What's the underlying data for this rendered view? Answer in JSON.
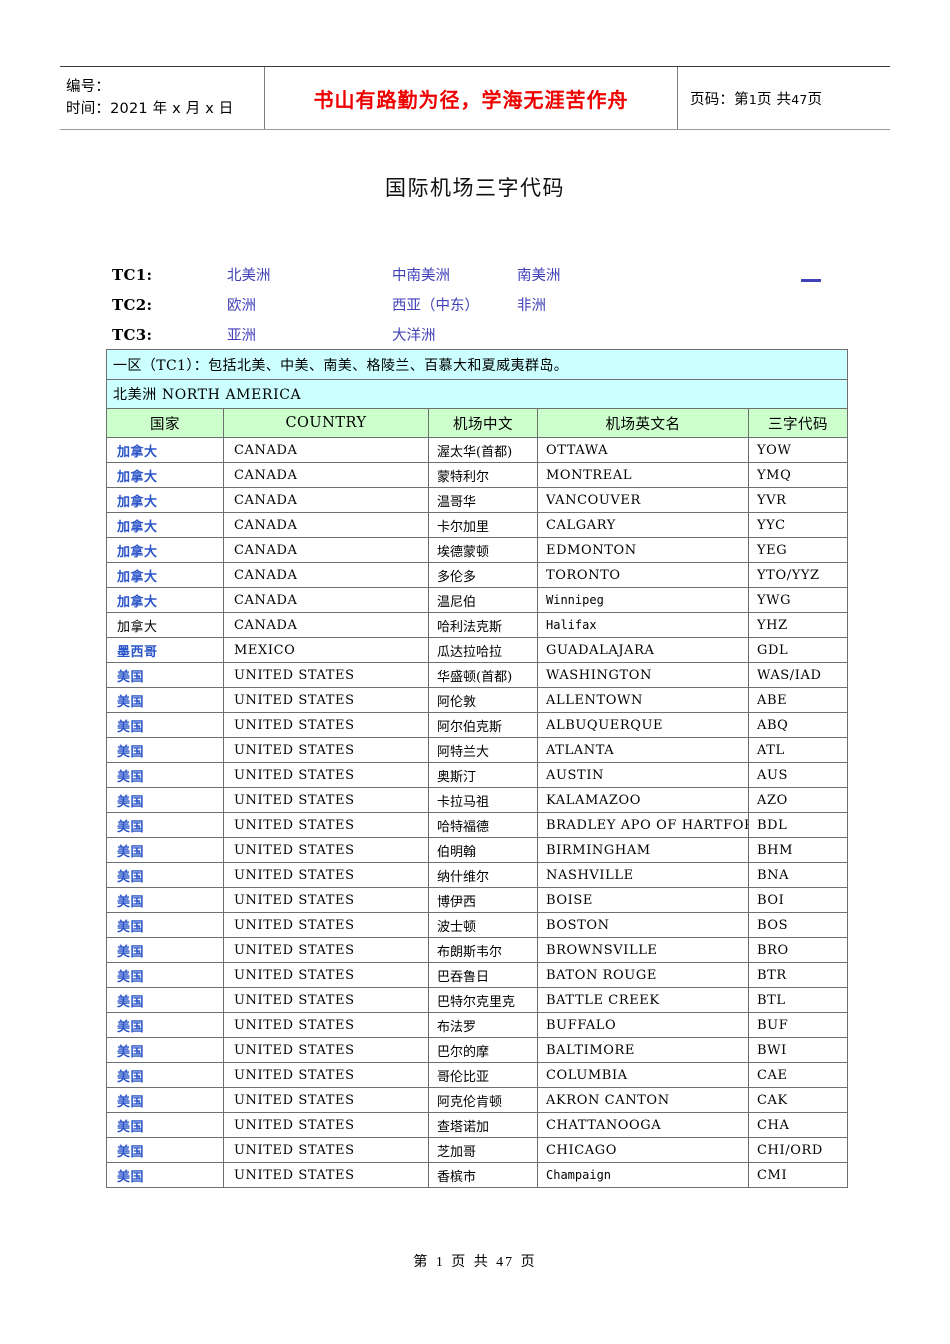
{
  "page_header": {
    "doc_number_label": "编号：",
    "date_label": "时间：2021 年 x 月 x 日",
    "motto": "书山有路勤为径，学海无涯苦作舟",
    "page_prefix": "页码：第",
    "page_current": "1",
    "page_mid": "页 共",
    "page_total": "47",
    "page_suffix": "页"
  },
  "title": "国际机场三字代码",
  "tc_index": {
    "rows": [
      {
        "label": "TC1:",
        "links": [
          "北美洲",
          "中南美洲",
          "南美洲"
        ]
      },
      {
        "label": "TC2:",
        "links": [
          "欧洲",
          "西亚（中东）",
          "非洲"
        ]
      },
      {
        "label": "TC3:",
        "links": [
          "亚洲",
          "大洋洲"
        ]
      }
    ]
  },
  "table": {
    "zone_banner": "一区（TC1）：包括北美、中美、南美、格陵兰、百慕大和夏威夷群岛。",
    "region_banner": "北美洲  NORTH  AMERICA",
    "headers": [
      "国家",
      "COUNTRY",
      "机场中文",
      "机场英文名",
      "三字代码"
    ],
    "rows": [
      {
        "country_cn": "加拿大",
        "country_en": "CANADA",
        "airport_cn": "渥太华(首都)",
        "airport_en": "OTTAWA",
        "code": "YOW",
        "cn_link": true,
        "en_mono": false
      },
      {
        "country_cn": "加拿大",
        "country_en": "CANADA",
        "airport_cn": "蒙特利尔",
        "airport_en": "MONTREAL",
        "code": "YMQ",
        "cn_link": true,
        "en_mono": false
      },
      {
        "country_cn": "加拿大",
        "country_en": "CANADA",
        "airport_cn": "温哥华",
        "airport_en": "VANCOUVER",
        "code": "YVR",
        "cn_link": true,
        "en_mono": false
      },
      {
        "country_cn": "加拿大",
        "country_en": "CANADA",
        "airport_cn": "卡尔加里",
        "airport_en": "CALGARY",
        "code": "YYC",
        "cn_link": true,
        "en_mono": false
      },
      {
        "country_cn": "加拿大",
        "country_en": "CANADA",
        "airport_cn": "埃德蒙顿",
        "airport_en": "EDMONTON",
        "code": "YEG",
        "cn_link": true,
        "en_mono": false
      },
      {
        "country_cn": "加拿大",
        "country_en": "CANADA",
        "airport_cn": "多伦多",
        "airport_en": "TORONTO",
        "code": "YTO/YYZ",
        "cn_link": true,
        "en_mono": false
      },
      {
        "country_cn": "加拿大",
        "country_en": "CANADA",
        "airport_cn": "温尼伯",
        "airport_en": "Winnipeg",
        "code": "YWG",
        "cn_link": true,
        "en_mono": true
      },
      {
        "country_cn": "加拿大",
        "country_en": "CANADA",
        "airport_cn": "哈利法克斯",
        "airport_en": "Halifax",
        "code": "YHZ",
        "cn_link": false,
        "en_mono": true
      },
      {
        "country_cn": "墨西哥",
        "country_en": "MEXICO",
        "airport_cn": "瓜达拉哈拉",
        "airport_en": "GUADALAJARA",
        "code": "GDL",
        "cn_link": true,
        "en_mono": false
      },
      {
        "country_cn": "美国",
        "country_en": "UNITED STATES",
        "airport_cn": "华盛顿(首都)",
        "airport_en": "WASHINGTON",
        "code": "WAS/IAD",
        "cn_link": true,
        "en_mono": false
      },
      {
        "country_cn": "美国",
        "country_en": "UNITED STATES",
        "airport_cn": "阿伦敦",
        "airport_en": "ALLENTOWN",
        "code": "ABE",
        "cn_link": true,
        "en_mono": false
      },
      {
        "country_cn": "美国",
        "country_en": "UNITED STATES",
        "airport_cn": "阿尔伯克斯",
        "airport_en": "ALBUQUERQUE",
        "code": "ABQ",
        "cn_link": true,
        "en_mono": false
      },
      {
        "country_cn": "美国",
        "country_en": "UNITED STATES",
        "airport_cn": "阿特兰大",
        "airport_en": "ATLANTA",
        "code": "ATL",
        "cn_link": true,
        "en_mono": false
      },
      {
        "country_cn": "美国",
        "country_en": "UNITED STATES",
        "airport_cn": "奥斯汀",
        "airport_en": "AUSTIN",
        "code": "AUS",
        "cn_link": true,
        "en_mono": false
      },
      {
        "country_cn": "美国",
        "country_en": "UNITED STATES",
        "airport_cn": "卡拉马祖",
        "airport_en": "KALAMAZOO",
        "code": "AZO",
        "cn_link": true,
        "en_mono": false
      },
      {
        "country_cn": "美国",
        "country_en": "UNITED STATES",
        "airport_cn": "哈特福德",
        "airport_en": "BRADLEY APO OF HARTFORD",
        "code": "BDL",
        "cn_link": true,
        "en_mono": false
      },
      {
        "country_cn": "美国",
        "country_en": "UNITED STATES",
        "airport_cn": "伯明翰",
        "airport_en": "BIRMINGHAM",
        "code": "BHM",
        "cn_link": true,
        "en_mono": false
      },
      {
        "country_cn": "美国",
        "country_en": "UNITED STATES",
        "airport_cn": "纳什维尔",
        "airport_en": "NASHVILLE",
        "code": "BNA",
        "cn_link": true,
        "en_mono": false
      },
      {
        "country_cn": "美国",
        "country_en": "UNITED STATES",
        "airport_cn": "博伊西",
        "airport_en": "BOISE",
        "code": "BOI",
        "cn_link": true,
        "en_mono": false
      },
      {
        "country_cn": "美国",
        "country_en": "UNITED STATES",
        "airport_cn": "波士顿",
        "airport_en": "BOSTON",
        "code": "BOS",
        "cn_link": true,
        "en_mono": false
      },
      {
        "country_cn": "美国",
        "country_en": "UNITED STATES",
        "airport_cn": "布朗斯韦尔",
        "airport_en": "BROWNSVILLE",
        "code": "BRO",
        "cn_link": true,
        "en_mono": false
      },
      {
        "country_cn": "美国",
        "country_en": "UNITED STATES",
        "airport_cn": "巴吞鲁日",
        "airport_en": "BATON ROUGE",
        "code": "BTR",
        "cn_link": true,
        "en_mono": false
      },
      {
        "country_cn": "美国",
        "country_en": "UNITED STATES",
        "airport_cn": "巴特尔克里克",
        "airport_en": "BATTLE CREEK",
        "code": "BTL",
        "cn_link": true,
        "en_mono": false
      },
      {
        "country_cn": "美国",
        "country_en": "UNITED STATES",
        "airport_cn": "布法罗",
        "airport_en": "BUFFALO",
        "code": "BUF",
        "cn_link": true,
        "en_mono": false
      },
      {
        "country_cn": "美国",
        "country_en": "UNITED STATES",
        "airport_cn": "巴尔的摩",
        "airport_en": "BALTIMORE",
        "code": "BWI",
        "cn_link": true,
        "en_mono": false
      },
      {
        "country_cn": "美国",
        "country_en": "UNITED STATES",
        "airport_cn": "哥伦比亚",
        "airport_en": "COLUMBIA",
        "code": "CAE",
        "cn_link": true,
        "en_mono": false
      },
      {
        "country_cn": "美国",
        "country_en": "UNITED STATES",
        "airport_cn": "阿克伦肯顿",
        "airport_en": "AKRON   CANTON",
        "code": "CAK",
        "cn_link": true,
        "en_mono": false
      },
      {
        "country_cn": "美国",
        "country_en": "UNITED STATES",
        "airport_cn": "查塔诺加",
        "airport_en": "CHATTANOOGA",
        "code": "CHA",
        "cn_link": true,
        "en_mono": false
      },
      {
        "country_cn": "美国",
        "country_en": "UNITED STATES",
        "airport_cn": "芝加哥",
        "airport_en": "CHICAGO",
        "code": "CHI/ORD",
        "cn_link": true,
        "en_mono": false
      },
      {
        "country_cn": "美国",
        "country_en": "UNITED STATES",
        "airport_cn": "香槟市",
        "airport_en": "Champaign",
        "code": "CMI",
        "cn_link": true,
        "en_mono": true
      }
    ]
  },
  "footer": {
    "prefix": "第",
    "current": "1",
    "mid": "页 共",
    "total": "47",
    "suffix": "页"
  },
  "colors": {
    "banner_cyan": "#ccffff",
    "header_green": "#ccffcc",
    "link_blue": "#2b55c8",
    "tc_link_blue": "#4242b8",
    "motto_red": "#ee0000"
  }
}
